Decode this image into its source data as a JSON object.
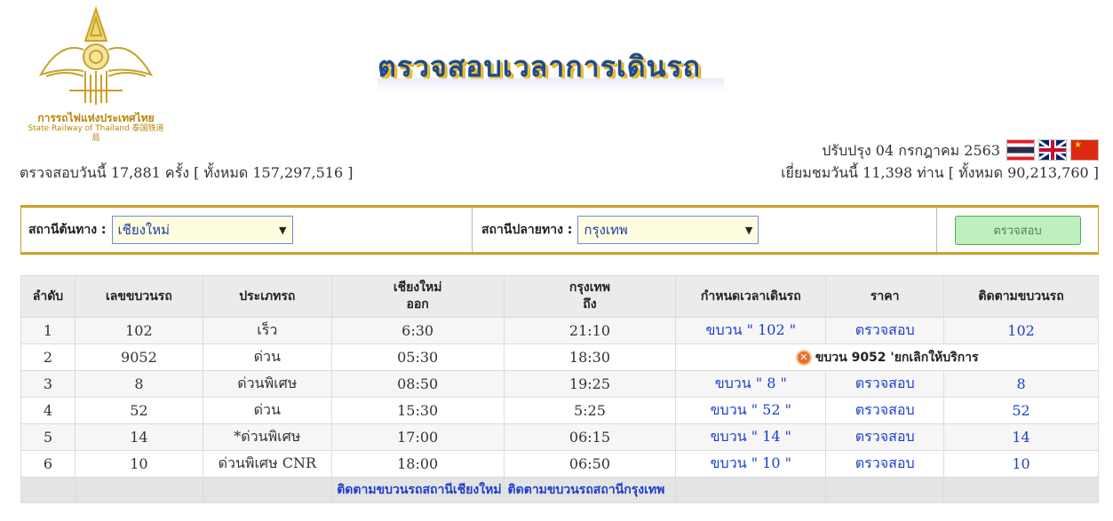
{
  "header": {
    "logo": {
      "name_th": "การรถไฟแห่งประเทศไทย",
      "name_en": "State Railway of Thailand 泰国铁道局"
    },
    "title": "ตรวจสอบเวลาการเดินรถ",
    "updated": "ปรับปรุง 04 กรกฎาคม 2563",
    "flags": [
      "thai-flag-icon",
      "uk-flag-icon",
      "china-flag-icon"
    ],
    "count_left": "ตรวจสอบวันนี้ 17,881 ครั้ง [ ทั้งหมด  157,297,516  ]",
    "count_right": "เยี่ยมชมวันนี้ 11,398 ท่าน [ ทั้งหมด  90,213,760 ]"
  },
  "search": {
    "origin_label": "สถานีต้นทาง :",
    "origin_value": "เชียงใหม่",
    "dest_label": "สถานีปลายทาง :",
    "dest_value": "กรุงเทพ",
    "submit_label": "ตรวจสอบ"
  },
  "table": {
    "headers": {
      "no": "ลำดับ",
      "train_no": "เลขขบวนรถ",
      "type": "ประเภทรถ",
      "depart_station": "เชียงใหม่",
      "depart_word": "ออก",
      "arrive_station": "กรุงเทพ",
      "arrive_word": "ถึง",
      "schedule": "กำหนดเวลาเดินรถ",
      "price": "ราคา",
      "track": "ติดตามขบวนรถ"
    },
    "rows": [
      {
        "no": "1",
        "train": "102",
        "type": "เร็ว",
        "depart": "6:30",
        "arrive": "21:10",
        "schedule": "ขบวน \" 102 \"",
        "price": "ตรวจสอบ",
        "track": "102"
      },
      {
        "no": "2",
        "train": "9052",
        "type": "ด่วน",
        "depart": "05:30",
        "arrive": "18:30",
        "cancel": "ขบวน 9052 'ยกเลิกให้บริการ"
      },
      {
        "no": "3",
        "train": "8",
        "type": "ด่วนพิเศษ",
        "depart": "08:50",
        "arrive": "19:25",
        "schedule": "ขบวน \" 8 \"",
        "price": "ตรวจสอบ",
        "track": "8"
      },
      {
        "no": "4",
        "train": "52",
        "type": "ด่วน",
        "depart": "15:30",
        "arrive": "5:25",
        "schedule": "ขบวน \" 52 \"",
        "price": "ตรวจสอบ",
        "track": "52"
      },
      {
        "no": "5",
        "train": "14",
        "type": "*ด่วนพิเศษ",
        "depart": "17:00",
        "arrive": "06:15",
        "schedule": "ขบวน \" 14 \"",
        "price": "ตรวจสอบ",
        "track": "14"
      },
      {
        "no": "6",
        "train": "10",
        "type": "ด่วนพิเศษ CNR",
        "depart": "18:00",
        "arrive": "06:50",
        "schedule": "ขบวน \" 10 \"",
        "price": "ตรวจสอบ",
        "track": "10"
      }
    ],
    "footer": {
      "track_origin": "ติดตามขบวนรถสถานีเชียงใหม่",
      "track_dest": "ติดตามขบวนรถสถานีกรุงเทพ"
    }
  }
}
